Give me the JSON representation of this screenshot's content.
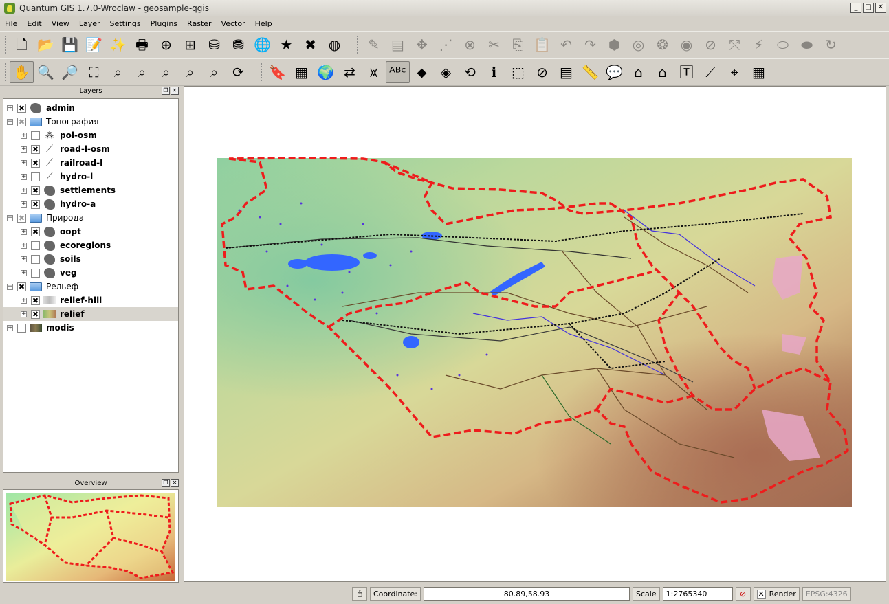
{
  "window": {
    "title": "Quantum GIS 1.7.0-Wroclaw - geosample-qgis",
    "minimize": "_",
    "maximize": "□",
    "close": "✕"
  },
  "menu": [
    "File",
    "Edit",
    "View",
    "Layer",
    "Settings",
    "Plugins",
    "Raster",
    "Vector",
    "Help"
  ],
  "toolbar1": [
    {
      "icon": "new-project-icon",
      "glyph": "🗋"
    },
    {
      "icon": "open-project-icon",
      "glyph": "📂"
    },
    {
      "icon": "save-project-icon",
      "glyph": "💾"
    },
    {
      "icon": "save-as-icon",
      "glyph": "📝"
    },
    {
      "icon": "new-print-composer-icon",
      "glyph": "✨"
    },
    {
      "icon": "print-icon",
      "glyph": "🖶"
    },
    {
      "icon": "add-vector-layer-icon",
      "glyph": "⊕"
    },
    {
      "icon": "add-raster-layer-icon",
      "glyph": "⊞"
    },
    {
      "icon": "add-postgis-layer-icon",
      "glyph": "⛁"
    },
    {
      "icon": "add-spatialite-layer-icon",
      "glyph": "⛃"
    },
    {
      "icon": "add-wms-layer-icon",
      "glyph": "🌐"
    },
    {
      "icon": "new-vector-layer-icon",
      "glyph": "★"
    },
    {
      "icon": "remove-layer-icon",
      "glyph": "✖"
    },
    {
      "icon": "add-wfs-layer-icon",
      "glyph": "◍"
    }
  ],
  "toolbar1_edit": [
    {
      "icon": "toggle-editing-icon",
      "glyph": "✎"
    },
    {
      "icon": "save-edits-icon",
      "glyph": "▤"
    },
    {
      "icon": "move-feature-icon",
      "glyph": "✥"
    },
    {
      "icon": "node-tool-icon",
      "glyph": "⋰"
    },
    {
      "icon": "delete-selected-icon",
      "glyph": "⊗"
    },
    {
      "icon": "cut-features-icon",
      "glyph": "✂"
    },
    {
      "icon": "copy-features-icon",
      "glyph": "⎘"
    },
    {
      "icon": "paste-features-icon",
      "glyph": "📋"
    },
    {
      "icon": "undo-icon",
      "glyph": "↶"
    },
    {
      "icon": "redo-icon",
      "glyph": "↷"
    },
    {
      "icon": "simplify-feature-icon",
      "glyph": "⬢"
    },
    {
      "icon": "add-ring-icon",
      "glyph": "◎"
    },
    {
      "icon": "add-part-icon",
      "glyph": "❂"
    },
    {
      "icon": "delete-ring-icon",
      "glyph": "◉"
    },
    {
      "icon": "delete-part-icon",
      "glyph": "⊘"
    },
    {
      "icon": "reshape-features-icon",
      "glyph": "⤲"
    },
    {
      "icon": "split-features-icon",
      "glyph": "⚡"
    },
    {
      "icon": "merge-features-icon",
      "glyph": "⬭"
    },
    {
      "icon": "merge-attributes-icon",
      "glyph": "⬬"
    },
    {
      "icon": "rotate-point-symbols-icon",
      "glyph": "↻"
    }
  ],
  "toolbar2": [
    {
      "icon": "pan-icon",
      "glyph": "✋",
      "active": true
    },
    {
      "icon": "zoom-in-icon",
      "glyph": "🔍"
    },
    {
      "icon": "zoom-out-icon",
      "glyph": "🔎"
    },
    {
      "icon": "zoom-full-icon",
      "glyph": "⛶"
    },
    {
      "icon": "zoom-to-selection-icon",
      "glyph": "⌕"
    },
    {
      "icon": "zoom-to-layer-icon",
      "glyph": "⌕"
    },
    {
      "icon": "zoom-actual-size-icon",
      "glyph": "⌕"
    },
    {
      "icon": "zoom-last-icon",
      "glyph": "⌕"
    },
    {
      "icon": "zoom-next-icon",
      "glyph": "⌕"
    },
    {
      "icon": "refresh-icon",
      "glyph": "⟳"
    }
  ],
  "toolbar2_b": [
    {
      "icon": "new-bookmark-icon",
      "glyph": "🔖"
    },
    {
      "icon": "show-bookmarks-icon",
      "glyph": "▦"
    },
    {
      "icon": "map-tips-icon",
      "glyph": "🌍"
    },
    {
      "icon": "georeferencer-icon",
      "glyph": "⇄"
    },
    {
      "icon": "histogram-icon",
      "glyph": "⩙"
    },
    {
      "icon": "labeling-icon",
      "glyph": "ᴬᴮᶜ",
      "active": true
    },
    {
      "icon": "pin-labels-icon",
      "glyph": "⬥"
    },
    {
      "icon": "move-label-icon",
      "glyph": "◈"
    },
    {
      "icon": "rotate-label-icon",
      "glyph": "⟲"
    },
    {
      "icon": "identify-icon",
      "glyph": "ℹ"
    },
    {
      "icon": "select-features-icon",
      "glyph": "⬚"
    },
    {
      "icon": "deselect-icon",
      "glyph": "⊘"
    },
    {
      "icon": "attribute-table-icon",
      "glyph": "▤"
    },
    {
      "icon": "measure-line-icon",
      "glyph": "📏"
    },
    {
      "icon": "text-annotation-icon",
      "glyph": "💬"
    },
    {
      "icon": "home-user-icon",
      "glyph": "⌂"
    },
    {
      "icon": "home-icon",
      "glyph": "⌂"
    },
    {
      "icon": "text-annotation-dropdown-icon",
      "glyph": "🅃"
    },
    {
      "icon": "gps-tools-icon",
      "glyph": "⟋"
    },
    {
      "icon": "capture-coordinates-icon",
      "glyph": "⌖"
    },
    {
      "icon": "scale-bar-icon",
      "glyph": "▦"
    }
  ],
  "layers_panel": {
    "title": "Layers"
  },
  "layers": [
    {
      "name": "admin",
      "bold": true,
      "checked": "x",
      "type": "poly",
      "indent": 0,
      "expander": "+"
    },
    {
      "name": "Топография",
      "bold": false,
      "checked": "partial",
      "type": "folder",
      "indent": 0,
      "expander": "−"
    },
    {
      "name": "poi-osm",
      "bold": true,
      "checked": "",
      "type": "point",
      "indent": 1,
      "expander": "+"
    },
    {
      "name": "road-l-osm",
      "bold": true,
      "checked": "x",
      "type": "line",
      "indent": 1,
      "expander": "+"
    },
    {
      "name": "railroad-l",
      "bold": true,
      "checked": "x",
      "type": "line",
      "indent": 1,
      "expander": "+"
    },
    {
      "name": "hydro-l",
      "bold": true,
      "checked": "",
      "type": "line",
      "indent": 1,
      "expander": "+"
    },
    {
      "name": "settlements",
      "bold": true,
      "checked": "x",
      "type": "poly",
      "indent": 1,
      "expander": "+"
    },
    {
      "name": "hydro-a",
      "bold": true,
      "checked": "x",
      "type": "poly",
      "indent": 1,
      "expander": "+"
    },
    {
      "name": "Природа",
      "bold": false,
      "checked": "partial",
      "type": "folder",
      "indent": 0,
      "expander": "−"
    },
    {
      "name": "oopt",
      "bold": true,
      "checked": "x",
      "type": "poly",
      "indent": 1,
      "expander": "+"
    },
    {
      "name": "ecoregions",
      "bold": true,
      "checked": "",
      "type": "poly",
      "indent": 1,
      "expander": "+"
    },
    {
      "name": "soils",
      "bold": true,
      "checked": "",
      "type": "poly",
      "indent": 1,
      "expander": "+"
    },
    {
      "name": "veg",
      "bold": true,
      "checked": "",
      "type": "poly",
      "indent": 1,
      "expander": "+"
    },
    {
      "name": "Рельеф",
      "bold": false,
      "checked": "x",
      "type": "folder",
      "indent": 0,
      "expander": "−"
    },
    {
      "name": "relief-hill",
      "bold": true,
      "checked": "x",
      "type": "raster-grey",
      "indent": 1,
      "expander": "+"
    },
    {
      "name": "relief",
      "bold": true,
      "checked": "x",
      "type": "raster",
      "indent": 1,
      "expander": "+",
      "selected": true
    },
    {
      "name": "modis",
      "bold": true,
      "checked": "",
      "type": "raster-dark",
      "indent": 0,
      "expander": "+"
    }
  ],
  "overview_panel": {
    "title": "Overview"
  },
  "statusbar": {
    "coordinate_label": "Coordinate:",
    "coordinate_value": "80.89,58.93",
    "scale_label": "Scale",
    "scale_value": "1:2765340",
    "render_label": "Render",
    "crs_label": "EPSG:4326"
  },
  "colors": {
    "admin_boundary": "#ee1c1c",
    "water": "#2255ee",
    "roads": "#5a3a1a",
    "rail": "#111111",
    "oopt": "#e8a8c8"
  }
}
